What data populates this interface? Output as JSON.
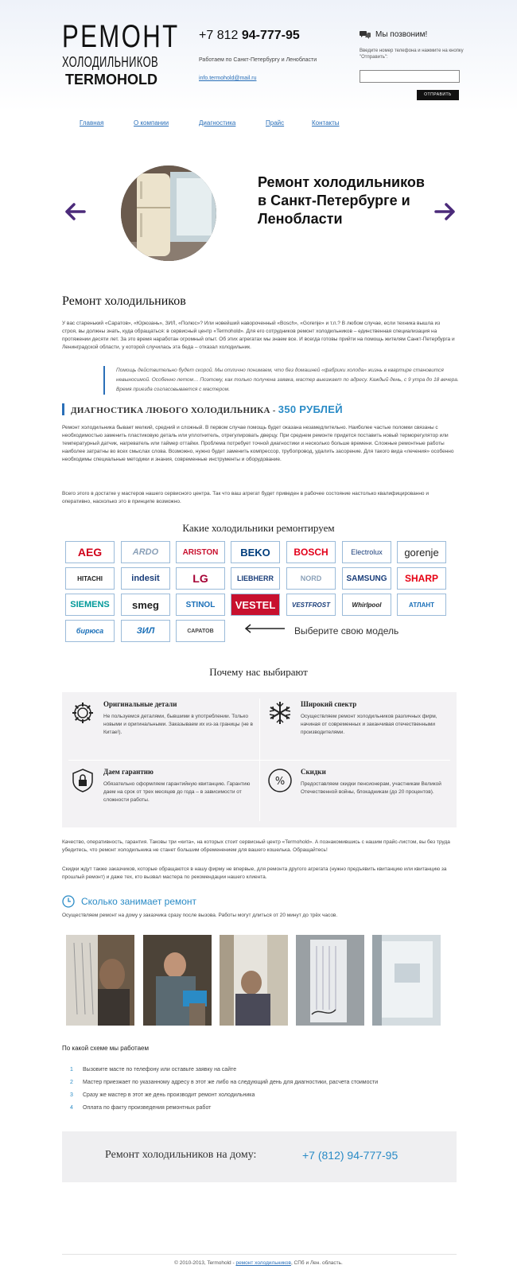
{
  "header": {
    "logo_line1": "РЕМОНТ",
    "logo_line2": "ХОЛОДИЛЬНИКОВ",
    "logo_line3": "TERMOHOLD",
    "phone_prefix": "+7 812",
    "phone_number": "94-777-95",
    "works_text": "Работаем по Санкт-Петербургу и Ленобласти",
    "email": "info.termohold@mail.ru",
    "callback_title": "Мы позвоним!",
    "callback_hint": "Введите номер телефона и нажмите на кнопку \"Отправить\":",
    "callback_input_value": "",
    "send_label": "ОТПРАВИТЬ"
  },
  "nav": {
    "items": [
      "Главная",
      "О компании",
      "Диагностика",
      "Прайс",
      "Контакты"
    ]
  },
  "slider": {
    "title": "Ремонт холодильников в Санкт-Петербурге и Ленобласти"
  },
  "intro": {
    "heading": "Ремонт холодильников",
    "paragraph": "У вас старенький «Саратов», «Юрюзань», ЗИЛ, «Полюс»? Или новейший навороченный «Bosch», «Gorenje» и т.п.? В любом случае, если техника вышла из строя, вы должны знать, куда обращаться: в сервисный центр «Termohold». Для его сотрудников ремонт холодильников – единственная специализация на протяжении десяти лет. За это время наработан огромный опыт. Об этих агрегатах мы знаем все. И всегда готовы прийти на помощь жителям Санкт-Петербурга и Ленинградской области, у которой случилась эта беда – отказал холодильник.",
    "quote": "Помощь действительно будет скорой. Мы отлично понимаем, что без домашней «фабрики холода» жизнь в квартире становится невыносимой. Особенно летом… Поэтому, как только получена заявка, мастер выезжает по адресу. Каждый день, с 9 утра до 18 вечера. Время приезда согласовывается с мастером."
  },
  "diagnostics": {
    "heading": "ДИАГНОСТИКА ЛЮБОГО ХОЛОДИЛЬНИКА -",
    "price": "350 РУБЛЕЙ",
    "paragraph1": "Ремонт холодильника бывает мелкий, средний и сложный. В первом случае помощь будет оказана незамедлительно. Наиболее частые поломки связаны с необходимостью заменить пластиковую деталь или уплотнитель, отрегулировать дверцу. При среднем ремонте придется поставить новый терморегулятор или температурный датчик, нагреватель или таймер оттайки. Проблема потребует точной диагностики и несколько больше времени. Сложные ремонтные работы наиболее затратны во всех смыслах слова. Возможно, нужно будет заменить компрессор, трубопровод, удалить засорение. Для такого вида «лечения» особенно необходимы специальные методики и знания, современные инструменты и оборудование.",
    "paragraph2": "Всего этого в достатке у мастеров нашего сервисного центра. Так что ваш агрегат будет приведен в рабочее состояние настолько квалифицированно и оперативно, насколько это в принципе возможно."
  },
  "brands": {
    "heading": "Какие холодильники ремонтируем",
    "items": [
      "AEG",
      "ARDO",
      "ARISTON",
      "BEKO",
      "BOSCH",
      "Electrolux",
      "gorenje",
      "HITACHI",
      "indesit",
      "LG",
      "LIEBHERR",
      "NORD",
      "SAMSUNG",
      "SHARP",
      "SIEMENS",
      "smeg",
      "STINOL",
      "VESTEL",
      "VESTFROST",
      "Whirlpool",
      "АТЛАНТ",
      "бирюса",
      "ЗИЛ",
      "САРАТОВ"
    ],
    "choose_text": "Выберите свою модель",
    "colors": {
      "aeg": "#d0021b",
      "ariston": "#c8102e",
      "beko": "#003d7c",
      "bosch": "#e2001a",
      "siemens": "#009999",
      "lg": "#a50034",
      "vestel": "#c8102e",
      "sharp": "#e60012"
    }
  },
  "why": {
    "heading": "Почему нас выбирают",
    "items": [
      {
        "icon": "gear-icon",
        "title": "Оригинальные детали",
        "desc": "Не пользуемся деталями, бывшими в употреблении. Только новыми и оригинальными. Заказываем их из-за границы (не в Китае!)."
      },
      {
        "icon": "snowflake-icon",
        "title": "Широкий спектр",
        "desc": "Осуществляем ремонт холодильников различных фирм, начиная от современных и заканчивая отечественными производителями."
      },
      {
        "icon": "lock-icon",
        "title": "Даем гарантию",
        "desc": "Обязательно оформляем гарантийную квитанцию. Гарантию даем на срок от трех месяцев до года – в зависимости от сложности работы."
      },
      {
        "icon": "percent-icon",
        "title": "Скидки",
        "desc": "Предоставляем скидки пенсионерам, участникам Великой Отечественной войны, блокадникам (до 20 процентов)."
      }
    ]
  },
  "after_why": {
    "paragraph1": "Качество, оперативность, гарантия. Таковы три «кита», на которых стоит сервисный центр «Termohold». А познакомившись с нашим прайс-листом, вы без труда убедитесь, что ремонт холодильника не станет большим обременением для вашего кошелька. Обращайтесь!",
    "paragraph2": "Скидки ждут также заказчиков, которые обращаются в нашу фирму не впервые, для ремонта другого агрегата (нужно предъявить квитанцию или квитанцию за прошлый ремонт) и даже тех, кто вызвал мастера по рекомендации нашего клиента."
  },
  "how_long": {
    "heading": "Сколько занимает ремонт",
    "text": "Осуществляем ремонт на дому у заказчика сразу после вызова. Работы могут длиться от 20 минут до трёх часов."
  },
  "scheme": {
    "heading": "По какой схеме мы работаем",
    "steps": [
      {
        "n": "1",
        "text": "Вызовите масте по телефону или оставьте заявку на сайте"
      },
      {
        "n": "2",
        "text": "Мастер приезжает по указанному адресу в этот же либо на следующий день для диагностики, расчета стоимости"
      },
      {
        "n": "3",
        "text": "Сразу же мастер в этот же день производит ремонт холодильника"
      },
      {
        "n": "4",
        "text": "Оплата по факту произведения ремонтных работ"
      }
    ]
  },
  "cta": {
    "text": "Ремонт холодильников на дому:",
    "phone": "+7 (812) 94-777-95"
  },
  "footer": {
    "prefix": "© 2010-2013, Termohold -",
    "link": "ремонт холодильников",
    "suffix": ", СПб и Лен. область."
  }
}
